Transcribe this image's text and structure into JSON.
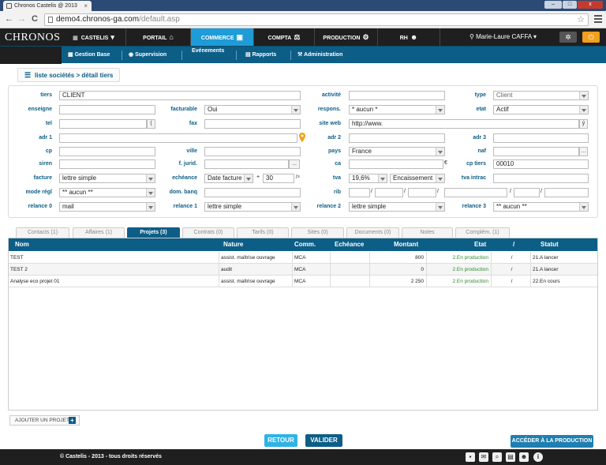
{
  "browser": {
    "tab_title": "Chronos Castelis @ 2013",
    "tab_close": "×",
    "url_host": "demo4.chronos-ga.com",
    "url_path": "/default.asp",
    "back": "←",
    "forward": "→",
    "reload": "C",
    "star": "☆",
    "minimize": "–",
    "maximize": "□",
    "close": "x"
  },
  "header": {
    "logo": "CHRONOS",
    "nav": [
      {
        "label": "CASTELIS",
        "icon": "▾",
        "icon_name": "chevron-down-icon"
      },
      {
        "label": "PORTAIL",
        "icon": "⌂",
        "icon_name": "home-icon"
      },
      {
        "label": "COMMERCE",
        "icon": "▣",
        "icon_name": "commerce-icon",
        "active": true
      },
      {
        "label": "COMPTA",
        "icon": "⚖",
        "icon_name": "compta-icon"
      },
      {
        "label": "PRODUCTION",
        "icon": "⚙",
        "icon_name": "gears-icon"
      },
      {
        "label": "RH",
        "icon": "☻",
        "icon_name": "people-icon"
      }
    ],
    "user_icon": "⚲",
    "user": "Marie-Laure CAFFA",
    "user_chevron": "▾",
    "gear": "✲",
    "power": "⏻"
  },
  "subnav": [
    {
      "label": "Gestion Base",
      "icon": "▦",
      "icon_name": "building-icon"
    },
    {
      "label": "Supervision",
      "icon": "◉",
      "icon_name": "eye-icon"
    },
    {
      "label": "Evénements",
      "icon": "",
      "icon_name": ""
    },
    {
      "label": "Rapports",
      "icon": "▤",
      "icon_name": "report-icon"
    },
    {
      "label": "Administration",
      "icon": "⚒",
      "icon_name": "admin-icon"
    }
  ],
  "breadcrumb": {
    "icon": "☰",
    "text": "liste sociétés > détail tiers"
  },
  "form": {
    "tiers": {
      "label": "tiers",
      "value": "CLIENT"
    },
    "activite": {
      "label": "activité",
      "value": ""
    },
    "type": {
      "label": "type",
      "value": "Client"
    },
    "enseigne": {
      "label": "enseigne",
      "value": ""
    },
    "facturable": {
      "label": "facturable",
      "value": "Oui"
    },
    "respons": {
      "label": "respons.",
      "value": "* aucun *"
    },
    "etat": {
      "label": "etat",
      "value": "Actif"
    },
    "tel": {
      "label": "tel",
      "value": "",
      "btn": "("
    },
    "fax": {
      "label": "fax",
      "value": ""
    },
    "site_web": {
      "label": "site web",
      "value": "http://www.",
      "btn": "ý"
    },
    "adr1": {
      "label": "adr 1",
      "value": ""
    },
    "adr2": {
      "label": "adr 2",
      "value": ""
    },
    "adr3": {
      "label": "adr 3",
      "value": ""
    },
    "cp": {
      "label": "cp",
      "value": ""
    },
    "ville": {
      "label": "ville",
      "value": ""
    },
    "pays": {
      "label": "pays",
      "value": "France"
    },
    "naf": {
      "label": "naf",
      "value": "",
      "btn": "..."
    },
    "siren": {
      "label": "siren",
      "value": ""
    },
    "f_jurid": {
      "label": "f. jurid.",
      "value": "",
      "btn": "..."
    },
    "ca": {
      "label": "ca",
      "value": "",
      "unit": "€"
    },
    "cp_tiers": {
      "label": "cp tiers",
      "value": "00010"
    },
    "facture": {
      "label": "facture",
      "value": "lettre simple"
    },
    "echeance": {
      "label": "echéance",
      "value": "Date facture",
      "plus": "+",
      "days": "30",
      "unit": "j's"
    },
    "tva": {
      "label": "tva",
      "value": "19,6%",
      "mode": "Encaissement"
    },
    "tva_intrac": {
      "label": "tva intrac",
      "value": ""
    },
    "mode_regl": {
      "label": "mode régl",
      "value": "** aucun **"
    },
    "dom_banq": {
      "label": "dom. banq",
      "value": ""
    },
    "rib": {
      "label": "rib",
      "sep": "/"
    },
    "relance0": {
      "label": "relance 0",
      "value": "mail"
    },
    "relance1": {
      "label": "relance 1",
      "value": "lettre simple"
    },
    "relance2": {
      "label": "relance 2",
      "value": "lettre simple"
    },
    "relance3": {
      "label": "relance 3",
      "value": "** aucun **"
    }
  },
  "tabs": [
    "Contacts (1)",
    "Affaires (1)",
    "Projets (3)",
    "Contrats (0)",
    "Tarifs (0)",
    "Sites (0)",
    "Documents (0)",
    "Notes",
    "Complém. (1)"
  ],
  "grid": {
    "columns": [
      "Nom",
      "Nature",
      "Comm.",
      "Echéance",
      "Montant",
      "Etat",
      "/",
      "Statut"
    ],
    "rows": [
      {
        "nom": "TEST",
        "nature": "assist. maîtrise ouvrage",
        "comm": "MCA",
        "echeance": "",
        "montant": "800",
        "etat": "2.En production",
        "slash": "/",
        "statut": "21.A lancer"
      },
      {
        "nom": "TEST 2",
        "nature": "audit",
        "comm": "MCA",
        "echeance": "",
        "montant": "0",
        "etat": "2.En production",
        "slash": "/",
        "statut": "21.A lancer"
      },
      {
        "nom": "Analyse eco projet 01",
        "nature": "assist. maîtrise ouvrage",
        "comm": "MCA",
        "echeance": "",
        "montant": "2 250",
        "etat": "2.En production",
        "slash": "/",
        "statut": "22.En cours"
      }
    ]
  },
  "actions": {
    "add_project": "AJOUTER UN PROJET",
    "add_plus": "+",
    "retour": "RETOUR",
    "valider": "VALIDER",
    "production": "ACCÉDER À LA PRODUCTION"
  },
  "footer": {
    "text": "© Castelis - 2013 - tous droits réservés",
    "icons": [
      {
        "glyph": "▪",
        "name": "sitemap-icon"
      },
      {
        "glyph": "✉",
        "name": "mail-icon"
      },
      {
        "glyph": "⌕",
        "name": "search-icon"
      },
      {
        "glyph": "▤",
        "name": "document-icon"
      },
      {
        "glyph": "☻",
        "name": "users-icon"
      },
      {
        "glyph": "i",
        "name": "info-icon"
      }
    ]
  },
  "colors": {
    "accent": "#1f9bd7",
    "dark_blue": "#0d5e87",
    "header": "#1f1f1f",
    "green_status": "#2f8a2f",
    "orange": "#f29f1d"
  }
}
